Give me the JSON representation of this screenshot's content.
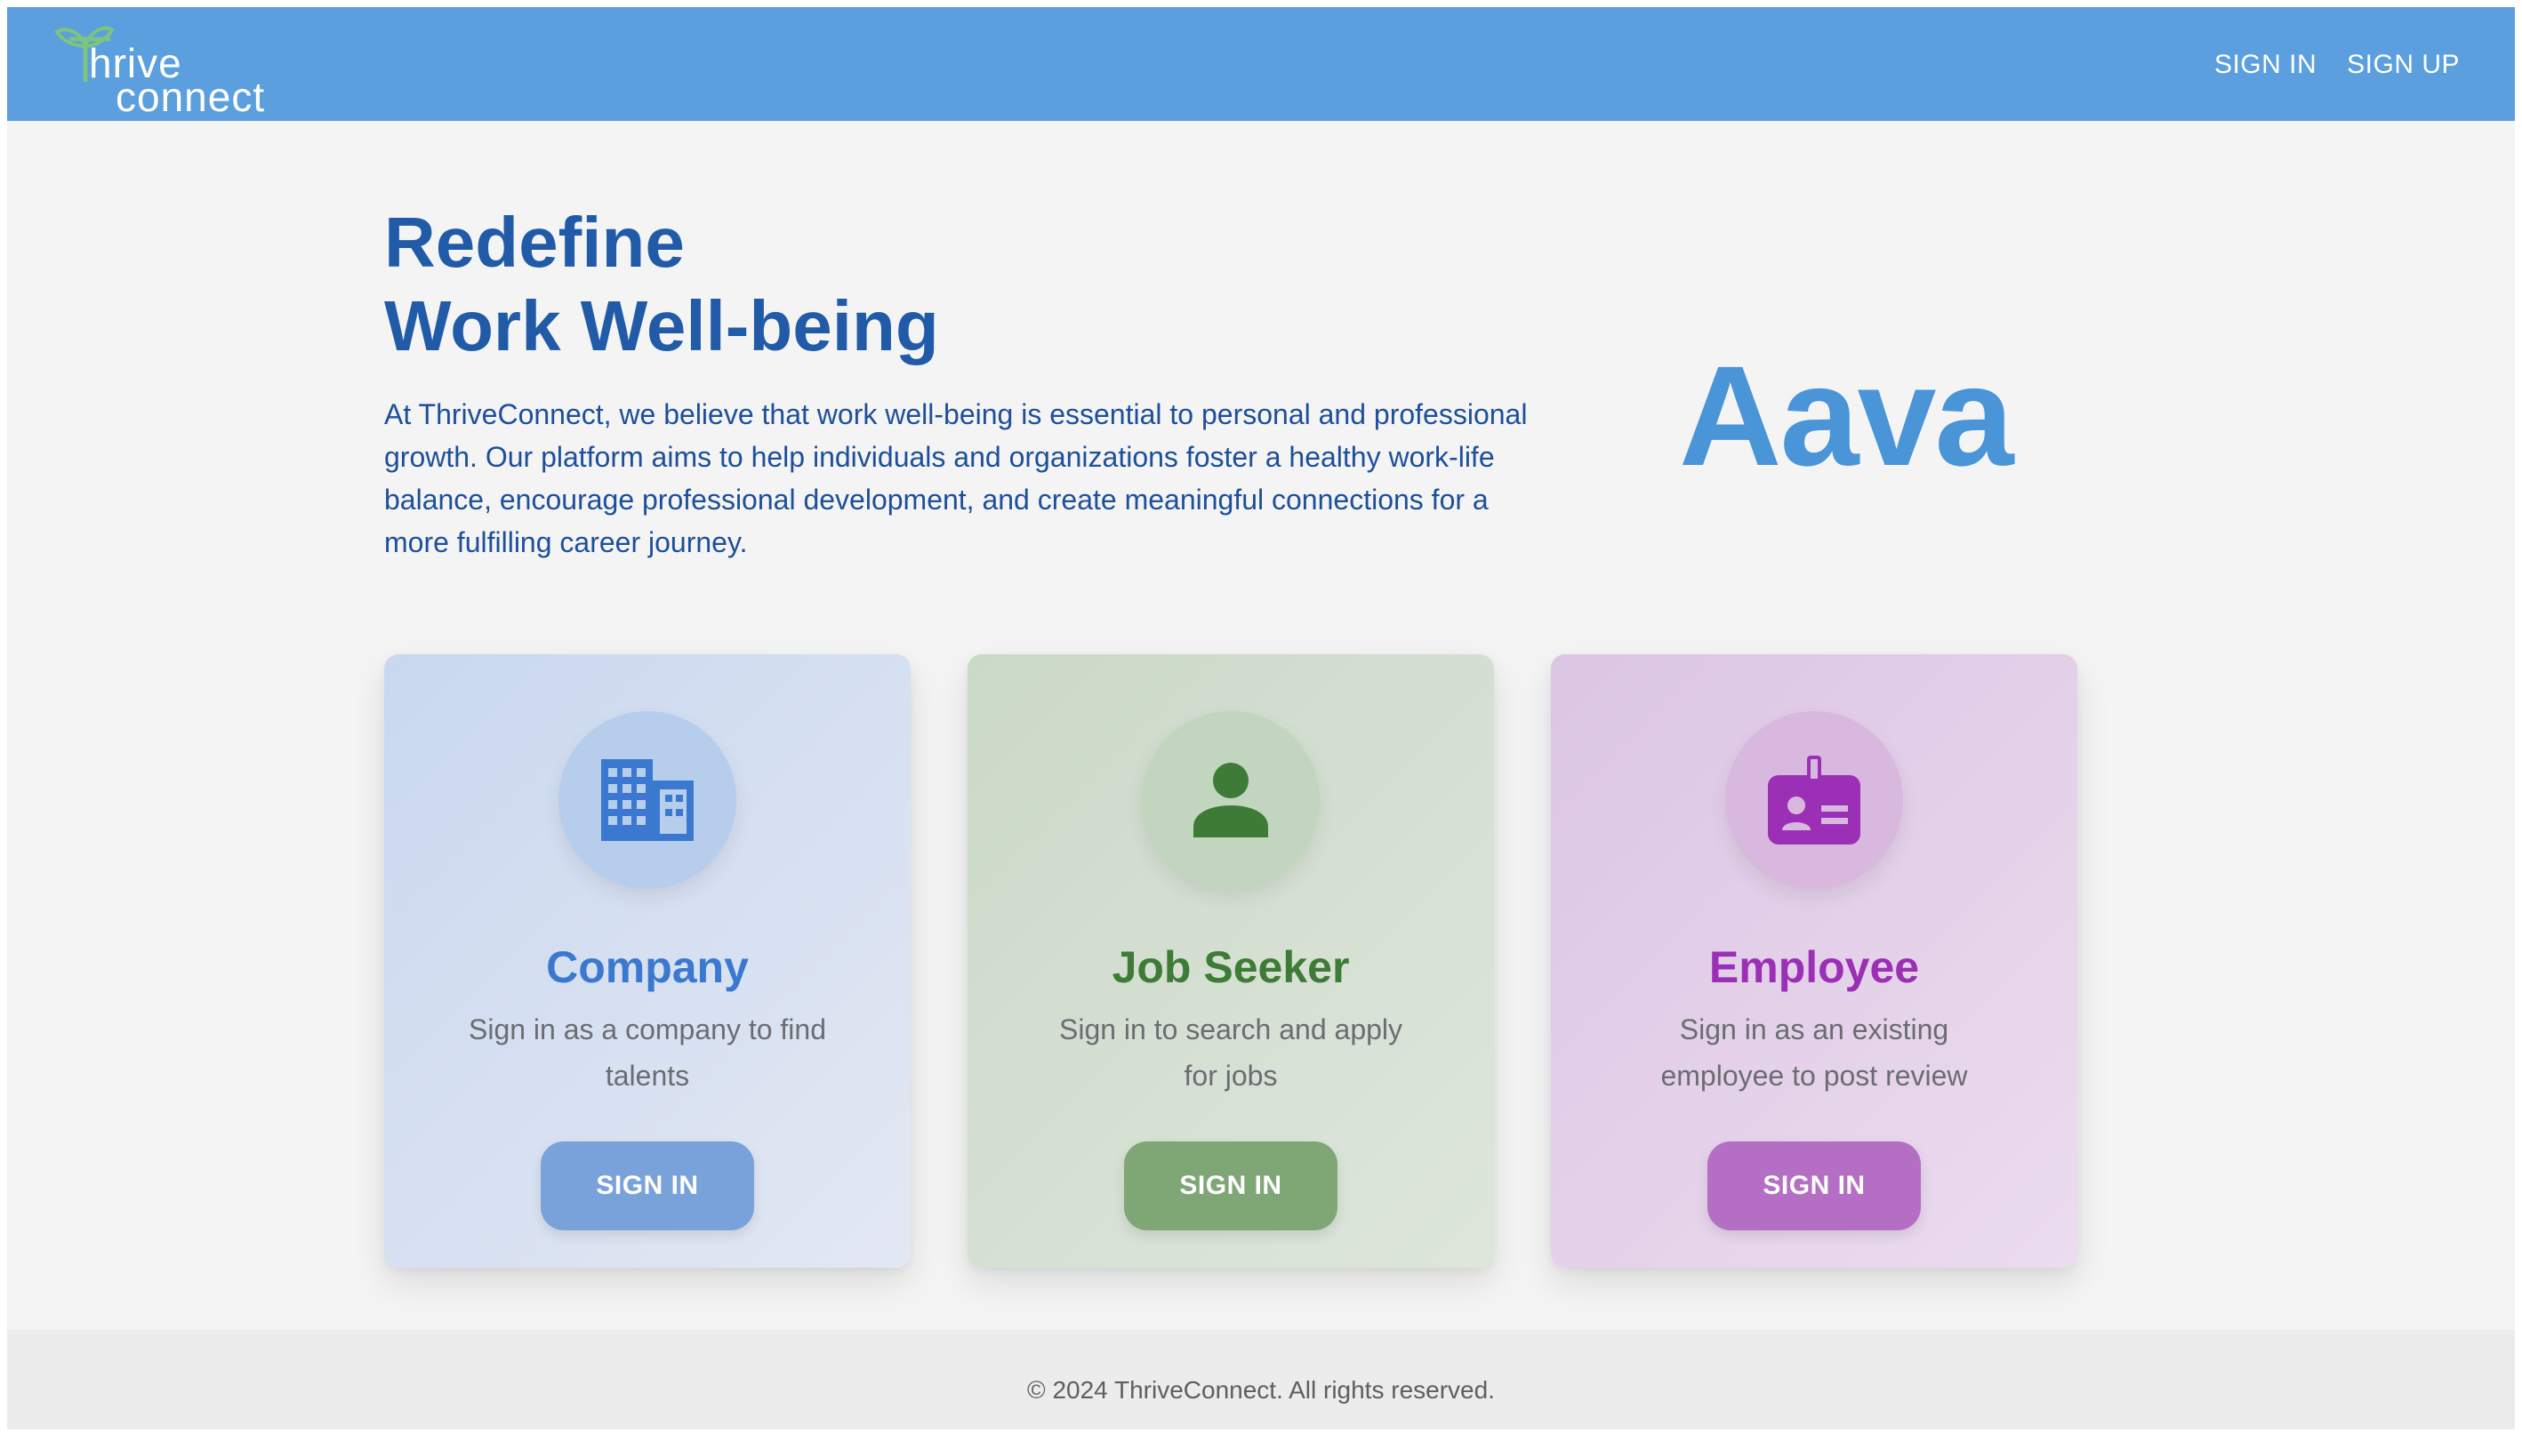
{
  "header": {
    "logo_line1": "hrive",
    "logo_line2": "connect",
    "logo_icon": "sprout-icon",
    "nav": [
      {
        "label": "SIGN IN"
      },
      {
        "label": "SIGN UP"
      }
    ],
    "colors": {
      "bar": "#5b9fdf",
      "logo_icon": "#7cc47f"
    }
  },
  "hero": {
    "title_line1": "Redefine",
    "title_line2": "Work Well-being",
    "description": "At ThriveConnect, we believe that work well-being is essential to personal and professional growth. Our platform aims to help individuals and organizations foster a healthy work-life balance, encourage professional development, and create meaningful connections for a more fulfilling career journey.",
    "brand_mark": "Aava"
  },
  "cards": [
    {
      "title": "Company",
      "description": "Sign in as a company to find talents",
      "button": "SIGN IN",
      "icon": "building-icon",
      "accent": "#3a79cf"
    },
    {
      "title": "Job Seeker",
      "description": "Sign in to search and apply for jobs",
      "button": "SIGN IN",
      "icon": "person-icon",
      "accent": "#3e7b37"
    },
    {
      "title": "Employee",
      "description": "Sign in as an existing employee to post review",
      "button": "SIGN IN",
      "icon": "badge-icon",
      "accent": "#9b2fb6"
    }
  ],
  "footer": {
    "copyright": "© 2024 ThriveConnect. All rights reserved."
  }
}
